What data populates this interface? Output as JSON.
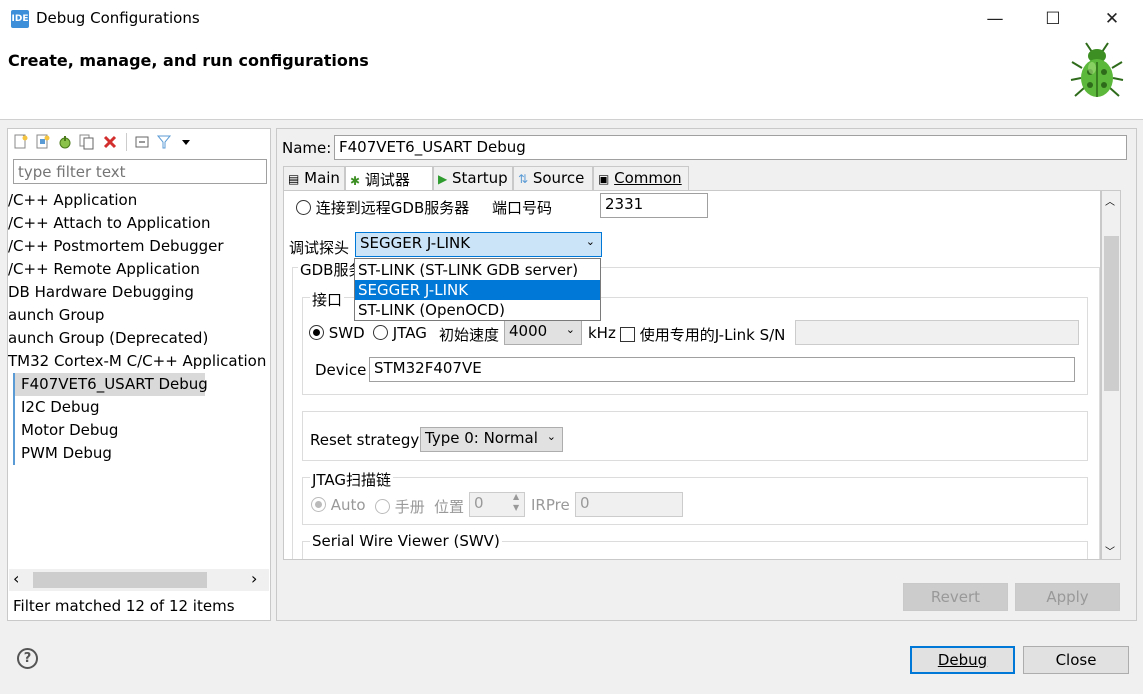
{
  "window": {
    "title": "Debug Configurations",
    "minimize": "—",
    "maximize": "☐",
    "close": "✕",
    "app_icon": "IDE"
  },
  "header": {
    "title": "Create, manage, and run configurations"
  },
  "left": {
    "filter_placeholder": "type filter text",
    "tree": [
      "/C++ Application",
      "/C++ Attach to Application",
      "/C++ Postmortem Debugger",
      "/C++ Remote Application",
      "DB Hardware Debugging",
      "aunch Group",
      "aunch Group (Deprecated)",
      "TM32 Cortex-M C/C++ Application",
      "F407VET6_USART Debug",
      "I2C Debug",
      "Motor Debug",
      "PWM Debug"
    ],
    "selected_index": 8,
    "status": "Filter matched 12 of 12 items",
    "scroll_left": "‹",
    "scroll_right": "›"
  },
  "right": {
    "name_label": "Name:",
    "name_value": "F407VET6_USART Debug",
    "tabs": [
      "Main",
      "调试器",
      "Startup",
      "Source",
      "Common"
    ],
    "active_tab": 1,
    "remote_gdb_label": "连接到远程GDB服务器",
    "port_label": "端口号码",
    "port_value": "2331",
    "probe_label": "调试探头",
    "probe_value": "SEGGER J-LINK",
    "probe_options": [
      "ST-LINK (ST-LINK GDB server)",
      "SEGGER J-LINK",
      "ST-LINK (OpenOCD)"
    ],
    "probe_highlight": 1,
    "gdb_group": "GDB服务",
    "interface_group": "接口",
    "swd_label": "SWD",
    "jtag_label": "JTAG",
    "speed_label": "初始速度",
    "speed_value": "4000",
    "khz_label": "kHz",
    "jlink_sn_label": "使用专用的J-Link S/N",
    "device_label": "Device",
    "device_value": "STM32F407VE",
    "reset_label": "Reset strategy",
    "reset_value": "Type 0: Normal",
    "jtag_chain_group": "JTAG扫描链",
    "auto_label": "Auto",
    "manual_label": "手册",
    "position_label": "位置",
    "position_value": "0",
    "irpre_label": "IRPre",
    "irpre_value": "0",
    "swv_group": "Serial Wire Viewer (SWV)",
    "revert_label": "Revert",
    "apply_label": "Apply"
  },
  "footer": {
    "help": "?",
    "debug_label": "Debug",
    "close_label": "Close"
  }
}
